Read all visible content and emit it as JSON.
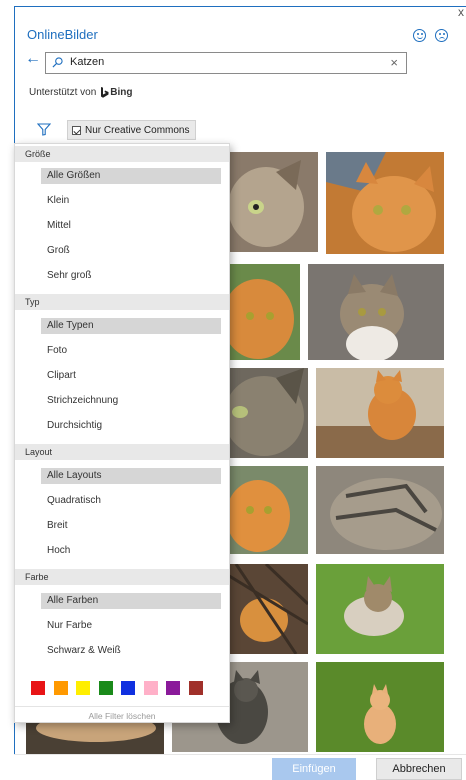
{
  "dialog": {
    "title": "OnlineBilder",
    "close_glyph": "x",
    "feedback_icons": [
      "smiley-happy-icon",
      "smiley-sad-icon"
    ]
  },
  "search": {
    "value": "Katzen",
    "placeholder": "",
    "clear_glyph": "×"
  },
  "powered_by": {
    "label": "Unterstützt von",
    "brand": "Bing"
  },
  "filter_bar": {
    "creative_commons_label": "Nur Creative Commons",
    "creative_commons_checked": true
  },
  "filters": {
    "sections": [
      {
        "header": "Größe",
        "options": [
          "Alle Größen",
          "Klein",
          "Mittel",
          "Groß",
          "Sehr groß"
        ],
        "selected": 0
      },
      {
        "header": "Typ",
        "options": [
          "Alle Typen",
          "Foto",
          "Clipart",
          "Strichzeichnung",
          "Durchsichtig"
        ],
        "selected": 0
      },
      {
        "header": "Layout",
        "options": [
          "Alle Layouts",
          "Quadratisch",
          "Breit",
          "Hoch"
        ],
        "selected": 0
      },
      {
        "header": "Farbe",
        "options": [
          "Alle Farben",
          "Nur Farbe",
          "Schwarz & Weiß"
        ],
        "selected": 0
      }
    ],
    "color_swatches": [
      "#e81416",
      "#ff9900",
      "#ffee00",
      "#1a8a1a",
      "#1030e0",
      "#ffb0c8",
      "#8a1a9a",
      "#a0302a"
    ],
    "clear_all_label": "Alle Filter löschen"
  },
  "footer": {
    "insert_label": "Einfügen",
    "cancel_label": "Abbrechen"
  },
  "colors": {
    "accent": "#1f6fbf",
    "insert_disabled": "#a9c8ee"
  }
}
